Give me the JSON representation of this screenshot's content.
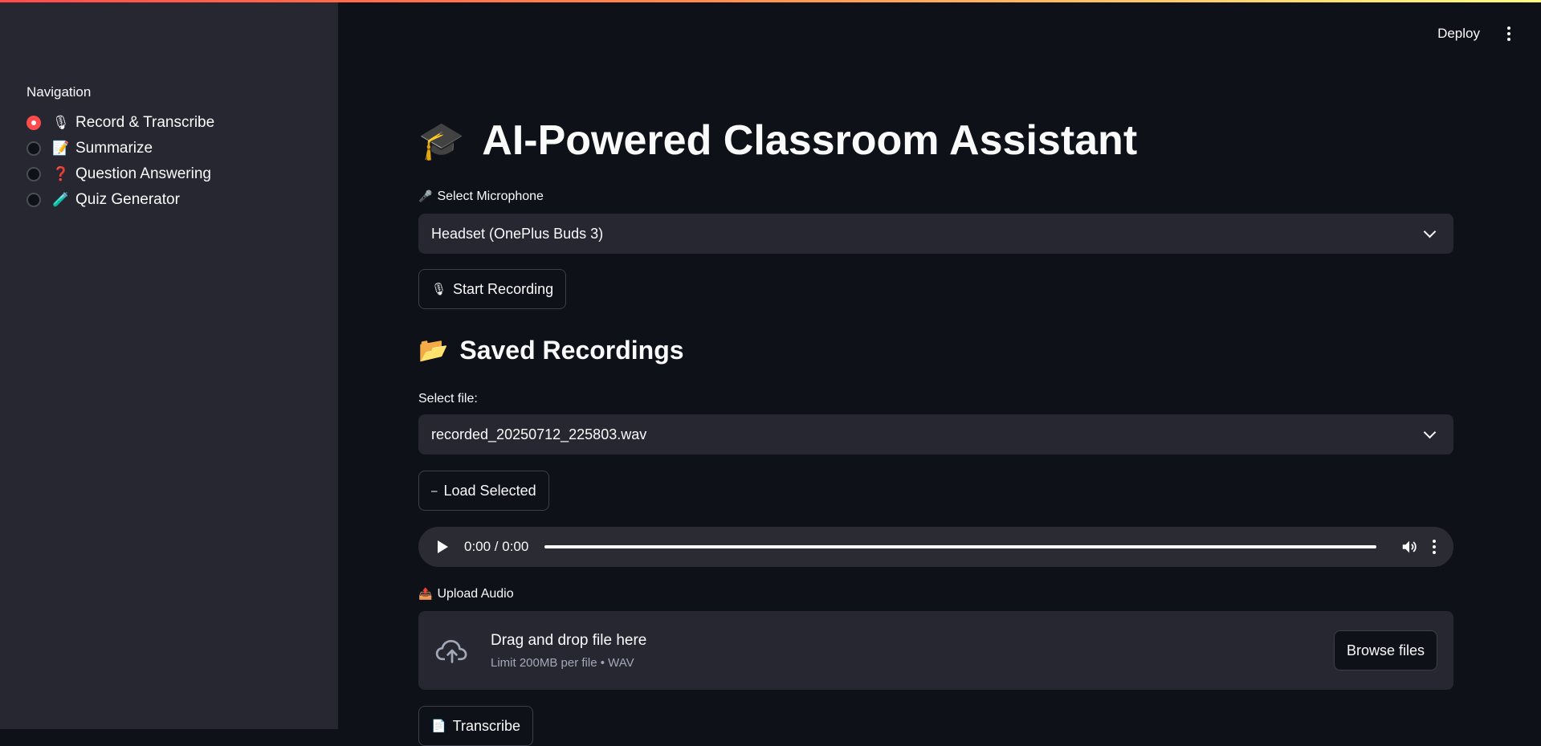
{
  "header": {
    "deploy_label": "Deploy"
  },
  "sidebar": {
    "nav_label": "Navigation",
    "items": [
      {
        "emoji": "🎙",
        "label": "Record & Transcribe",
        "selected": true
      },
      {
        "emoji": "📝",
        "label": "Summarize",
        "selected": false
      },
      {
        "emoji": "❓",
        "label": "Question Answering",
        "selected": false
      },
      {
        "emoji": "🧪",
        "label": "Quiz Generator",
        "selected": false
      }
    ]
  },
  "main": {
    "title_emoji": "🎓",
    "title": "AI-Powered Classroom Assistant",
    "mic_label_emoji": "🎤",
    "mic_label": "Select Microphone",
    "mic_value": "Headset (OnePlus Buds 3)",
    "start_emoji": "🎙",
    "start_label": "Start Recording",
    "saved_emoji": "📂",
    "saved_title": "Saved Recordings",
    "file_label": "Select file:",
    "file_value": "recorded_20250712_225803.wav",
    "load_emoji": "⎯",
    "load_label": "Load Selected",
    "audio_time": "0:00 / 0:00",
    "upload_emoji": "📤",
    "upload_label": "Upload Audio",
    "drop_title": "Drag and drop file here",
    "drop_sub": "Limit 200MB per file • WAV",
    "browse_label": "Browse files",
    "transcribe_emoji": "📄",
    "transcribe_label": "Transcribe"
  },
  "colors": {
    "accent": "#ff4b4b",
    "background": "#0e1117",
    "sidebar": "#262730"
  }
}
